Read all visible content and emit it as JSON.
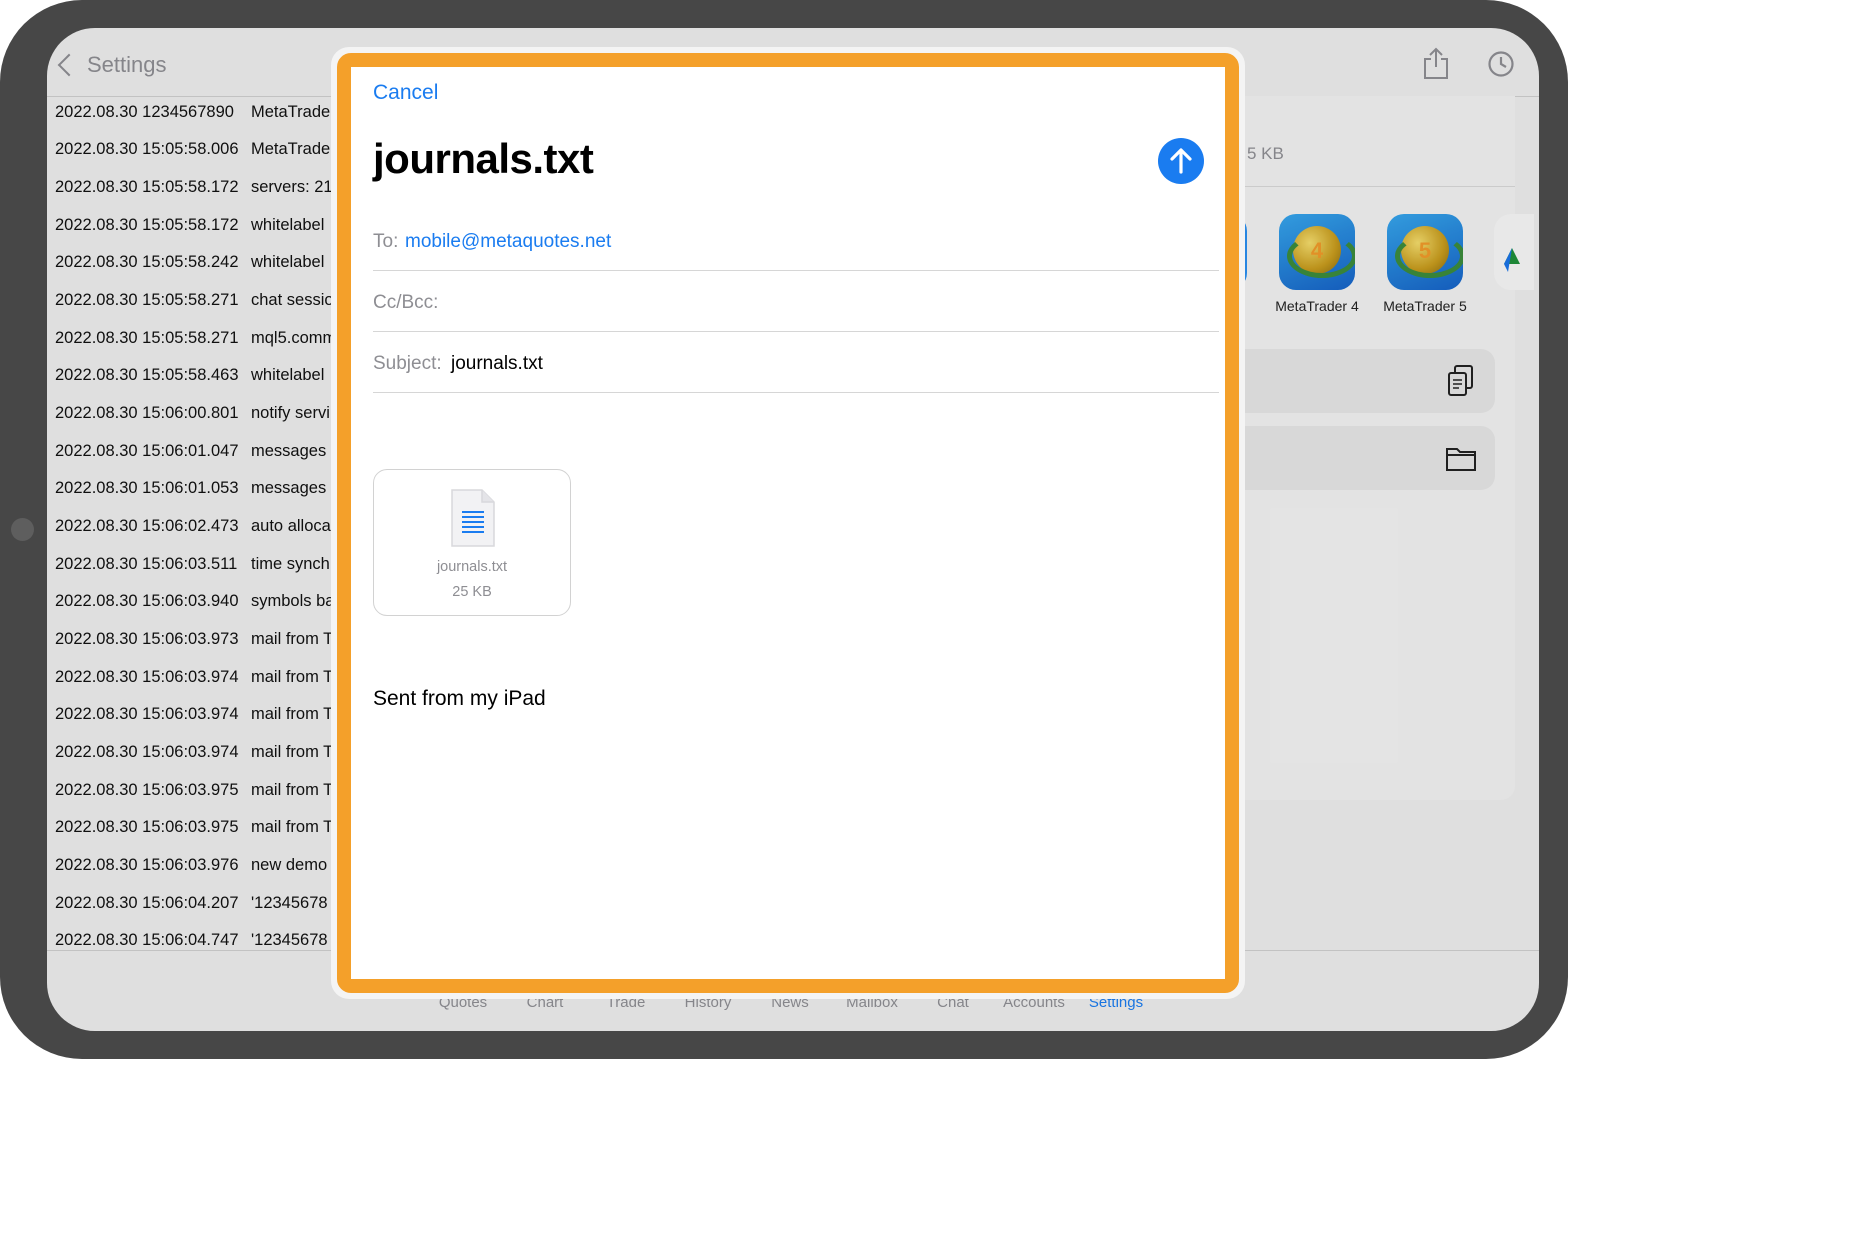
{
  "nav": {
    "back_label": "Settings"
  },
  "log_rows": [
    {
      "ts": "2022.08.30 1234567890",
      "msg": "MetaTrader"
    },
    {
      "ts": "2022.08.30 15:05:58.006",
      "msg": "MetaTrader"
    },
    {
      "ts": "2022.08.30 15:05:58.172",
      "msg": "servers: 21"
    },
    {
      "ts": "2022.08.30 15:05:58.172",
      "msg": "whitelabel"
    },
    {
      "ts": "2022.08.30 15:05:58.242",
      "msg": "whitelabel"
    },
    {
      "ts": "2022.08.30 15:05:58.271",
      "msg": "chat sessio"
    },
    {
      "ts": "2022.08.30 15:05:58.271",
      "msg": "mql5.comm"
    },
    {
      "ts": "2022.08.30 15:05:58.463",
      "msg": "whitelabel"
    },
    {
      "ts": "2022.08.30 15:06:00.801",
      "msg": "notify servi"
    },
    {
      "ts": "2022.08.30 15:06:01.047",
      "msg": "messages"
    },
    {
      "ts": "2022.08.30 15:06:01.053",
      "msg": "messages"
    },
    {
      "ts": "2022.08.30 15:06:02.473",
      "msg": "auto alloca"
    },
    {
      "ts": "2022.08.30 15:06:03.511",
      "msg": "time synch"
    },
    {
      "ts": "2022.08.30 15:06:03.940",
      "msg": "symbols ba"
    },
    {
      "ts": "2022.08.30 15:06:03.973",
      "msg": "mail from T"
    },
    {
      "ts": "2022.08.30 15:06:03.974",
      "msg": "mail from T"
    },
    {
      "ts": "2022.08.30 15:06:03.974",
      "msg": "mail from T"
    },
    {
      "ts": "2022.08.30 15:06:03.974",
      "msg": "mail from T"
    },
    {
      "ts": "2022.08.30 15:06:03.975",
      "msg": "mail from T"
    },
    {
      "ts": "2022.08.30 15:06:03.975",
      "msg": "mail from T"
    },
    {
      "ts": "2022.08.30 15:06:03.976",
      "msg": "new demo"
    },
    {
      "ts": "2022.08.30 15:06:04.207",
      "msg": "'12345678"
    },
    {
      "ts": "2022.08.30 15:06:04.747",
      "msg": "'12345678"
    }
  ],
  "share_sheet": {
    "size_label": "5 KB",
    "apps": [
      {
        "label": "MetaTrader 4",
        "badge": "4"
      },
      {
        "label": "MetaTrader 5",
        "badge": "5"
      }
    ],
    "actions": [
      {
        "icon": "copy-icon"
      },
      {
        "icon": "folder-icon"
      }
    ]
  },
  "tabs": [
    {
      "label": "Quotes",
      "active": false
    },
    {
      "label": "Chart",
      "active": false
    },
    {
      "label": "Trade",
      "active": false
    },
    {
      "label": "History",
      "active": false
    },
    {
      "label": "News",
      "active": false
    },
    {
      "label": "Mailbox",
      "active": false
    },
    {
      "label": "Chat",
      "active": false
    },
    {
      "label": "Accounts",
      "active": false
    },
    {
      "label": "Settings",
      "active": true
    }
  ],
  "compose": {
    "cancel_label": "Cancel",
    "title": "journals.txt",
    "to_label": "To:",
    "to_value": "mobile@metaquotes.net",
    "cc_label": "Cc/Bcc:",
    "subject_label": "Subject:",
    "subject_value": "journals.txt",
    "attachment": {
      "name": "journals.txt",
      "size": "25 KB"
    },
    "body": "Sent from my iPad"
  },
  "colors": {
    "accent": "#1a7cf0",
    "highlight_border": "#f4a02a",
    "bezel": "#474747"
  }
}
